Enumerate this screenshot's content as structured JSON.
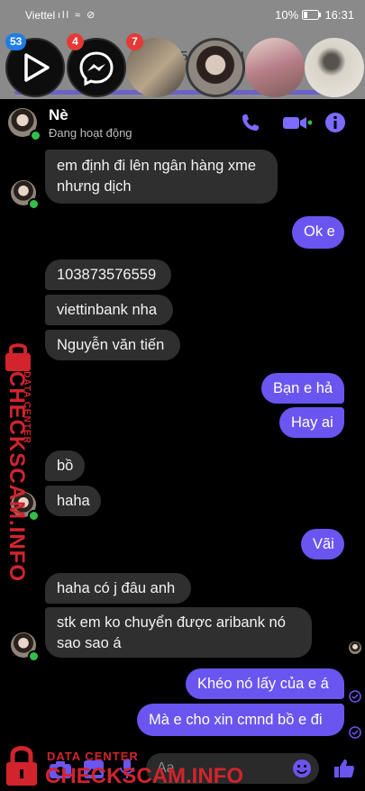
{
  "status_bar": {
    "carrier": "Viettel",
    "signal": "ıll ≈ ⊘",
    "battery": "10%",
    "time": "16:31"
  },
  "bubbles_strip": {
    "badges": [
      "53",
      "4",
      "7"
    ],
    "partial_text": "ng",
    "partial_text_2": "5",
    "partial_text_3": "U"
  },
  "chat": {
    "name": "Nè",
    "status": "Đang hoạt động"
  },
  "messages": [
    {
      "side": "in",
      "text": "em định đi lên ngân hàng xme"
    },
    {
      "side": "in",
      "text": "nhưng dịch"
    },
    {
      "side": "out",
      "text": "Ok e"
    },
    {
      "side": "in",
      "text": "103873576559"
    },
    {
      "side": "in",
      "text": "viettinbank nha"
    },
    {
      "side": "in",
      "text": "Nguyễn văn tiến"
    },
    {
      "side": "out",
      "text": "Bạn e hả"
    },
    {
      "side": "out",
      "text": "Hay ai"
    },
    {
      "side": "in",
      "text": "bồ"
    },
    {
      "side": "in",
      "text": "haha"
    },
    {
      "side": "out",
      "text": "Vãi"
    },
    {
      "side": "in",
      "text": "haha có j đâu anh"
    },
    {
      "side": "in",
      "text": "stk em ko chuyển được aribank nó"
    },
    {
      "side": "in",
      "text": "sao sao á"
    },
    {
      "side": "out",
      "text": "Khéo nó lấy của e á"
    },
    {
      "side": "out",
      "text": "Mà e cho xin cmnd bồ e đi"
    }
  ],
  "composer": {
    "placeholder": "Aa"
  },
  "watermark": {
    "label": "DATA CENTER",
    "site": "CHECKSCAM.INFO"
  },
  "colors": {
    "accent": "#6b55f0",
    "incoming": "#2f2f2f",
    "online": "#31c04a",
    "watermark": "#d3232d"
  },
  "icons": [
    "phone-icon",
    "video-icon",
    "info-icon",
    "camera-icon",
    "image-icon",
    "mic-icon",
    "emoji-icon",
    "like-icon",
    "play-icon",
    "messenger-icon",
    "lock-icon"
  ]
}
